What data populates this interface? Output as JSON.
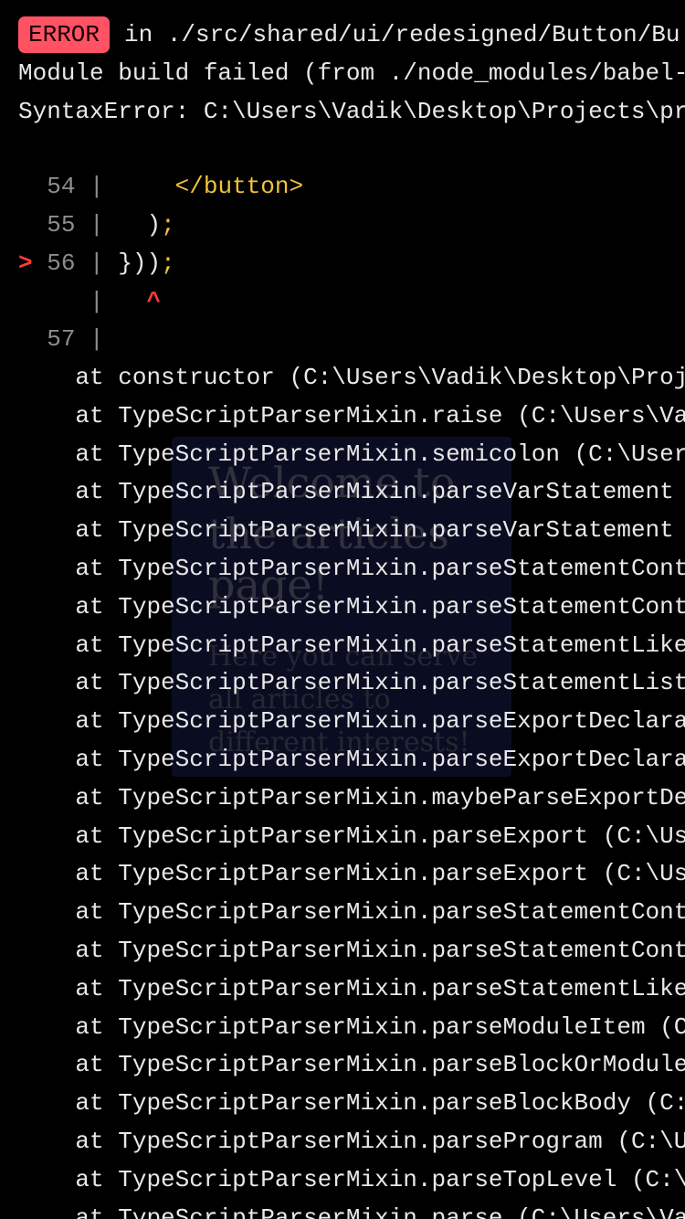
{
  "background_page": {
    "title": "Welcome to the articles page!",
    "text": "Here you can serve all articles to different interests!"
  },
  "error_overlay": {
    "badge": "ERROR",
    "message": "in ./src/shared/ui/redesigned/Button/Bu",
    "line2": "Module build failed (from ./node_modules/babel-",
    "line3": "SyntaxError: C:\\Users\\Vadik\\Desktop\\Projects\\pr",
    "code_frame": {
      "line54_no": "54",
      "line54_code": "</button>",
      "line55_no": "55",
      "line55_code": ")",
      "line55_semi": ";",
      "marker": ">",
      "line56_no": "56",
      "line56_code": "}))",
      "line56_semi": ";",
      "caret": "^",
      "line57_no": "57",
      "pipe": "|"
    },
    "stack_prefix": "at",
    "stack": [
      "constructor (C:\\Users\\Vadik\\Desktop\\Proj",
      "TypeScriptParserMixin.raise (C:\\Users\\Va",
      "TypeScriptParserMixin.semicolon (C:\\User",
      "TypeScriptParserMixin.parseVarStatement",
      "TypeScriptParserMixin.parseVarStatement",
      "TypeScriptParserMixin.parseStatementCont",
      "TypeScriptParserMixin.parseStatementCont",
      "TypeScriptParserMixin.parseStatementLike",
      "TypeScriptParserMixin.parseStatementList",
      "TypeScriptParserMixin.parseExportDeclara",
      "TypeScriptParserMixin.parseExportDeclara",
      "TypeScriptParserMixin.maybeParseExportDe",
      "TypeScriptParserMixin.parseExport (C:\\Us",
      "TypeScriptParserMixin.parseExport (C:\\Us",
      "TypeScriptParserMixin.parseStatementCont",
      "TypeScriptParserMixin.parseStatementCont",
      "TypeScriptParserMixin.parseStatementLike",
      "TypeScriptParserMixin.parseModuleItem (C",
      "TypeScriptParserMixin.parseBlockOrModule",
      "TypeScriptParserMixin.parseBlockBody (C:",
      "TypeScriptParserMixin.parseProgram (C:\\U",
      "TypeScriptParserMixin.parseTopLevel (C:\\",
      "TypeScriptParserMixin.parse (C:\\Users\\Va"
    ],
    "colors": {
      "background": "#000000",
      "text": "#e8e8e8",
      "badge": "#ff5263",
      "marker": "#ff3b3b",
      "code_highlight": "#f2c23b",
      "gutter": "#8d8d8d"
    }
  }
}
